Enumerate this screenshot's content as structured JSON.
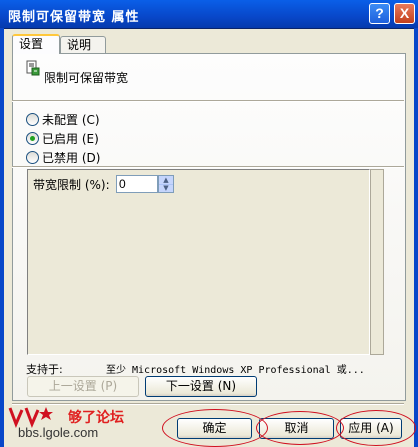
{
  "window": {
    "title": "限制可保留带宽 属性",
    "help_label": "?",
    "close_label": "X"
  },
  "tabs": [
    {
      "label": "设置",
      "selected": true
    },
    {
      "label": "说明",
      "selected": false
    }
  ],
  "policy": {
    "icon": "policy-setting-icon",
    "name": "限制可保留带宽"
  },
  "state_options": [
    {
      "label": "未配置 (C)",
      "checked": false
    },
    {
      "label": "已启用 (E)",
      "checked": true
    },
    {
      "label": "已禁用 (D)",
      "checked": false
    }
  ],
  "options": {
    "bandwidth_label": "带宽限制 (%):",
    "bandwidth_value": "0"
  },
  "supported": {
    "label": "支持于:",
    "value": "至少 Microsoft Windows XP Professional 或..."
  },
  "nav_buttons": {
    "prev_label": "上一设置 (P)",
    "prev_enabled": false,
    "next_label": "下一设置 (N)"
  },
  "dialog_buttons": {
    "ok_label": "确定",
    "cancel_label": "取消",
    "apply_label": "应用 (A)"
  },
  "watermark": {
    "site_name": "够了论坛",
    "url": "bbs.lgole.com"
  },
  "colors": {
    "titlebar": "#0847c9",
    "dialog_bg": "#ece9d8",
    "radio_dot": "#21a121",
    "annotation": "#d01020"
  }
}
